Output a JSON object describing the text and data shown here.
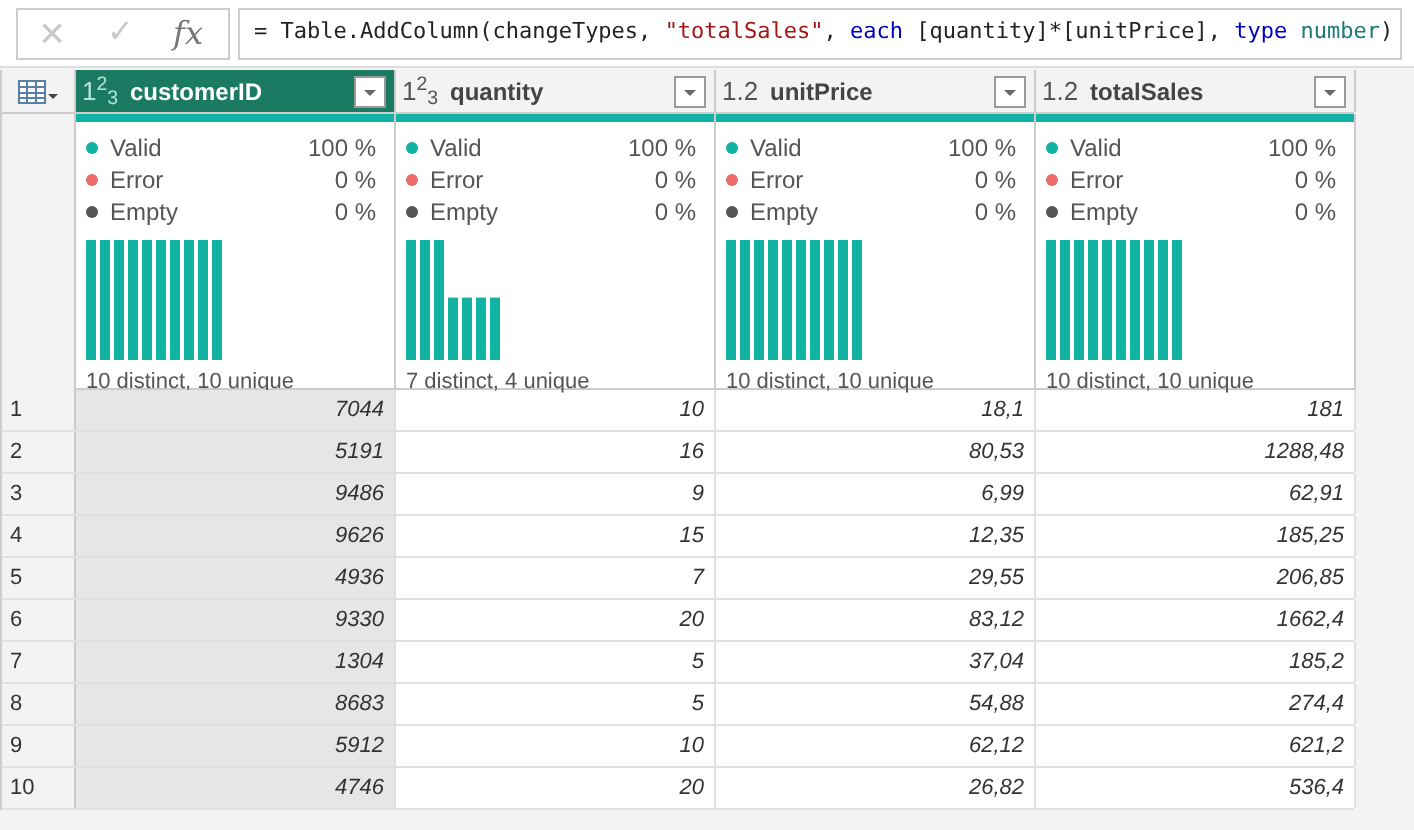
{
  "formula_bar": {
    "cancel": "×",
    "confirm": "✓",
    "fx": "fx",
    "formula": [
      {
        "kind": "plain",
        "text": "= Table.AddColumn(changeTypes, "
      },
      {
        "kind": "string",
        "text": "\"totalSales\""
      },
      {
        "kind": "plain",
        "text": ", "
      },
      {
        "kind": "keyword",
        "text": "each"
      },
      {
        "kind": "plain",
        "text": " [quantity]*[unitPrice], "
      },
      {
        "kind": "keyword",
        "text": "type"
      },
      {
        "kind": "type",
        "text": " number"
      },
      {
        "kind": "plain",
        "text": ")"
      }
    ]
  },
  "table": {
    "columns": [
      {
        "name": "customerID",
        "type_icon": "1$^{2}$$_{3}$",
        "selected": true,
        "stats": [
          {
            "label": "Valid",
            "value": "100 %"
          },
          {
            "label": "Error",
            "value": "0 %"
          },
          {
            "label": "Empty",
            "value": "0 %"
          }
        ],
        "profile": "10 distinct, 10 unique"
      },
      {
        "name": "quantity",
        "type_icon": "1$^{2}$$_{3}$",
        "selected": false,
        "stats": [
          {
            "label": "Valid",
            "value": "100 %"
          },
          {
            "label": "Error",
            "value": "0 %"
          },
          {
            "label": "Empty",
            "value": "0 %"
          }
        ],
        "profile": "7 distinct, 4 unique"
      },
      {
        "name": "unitPrice",
        "type_icon": "1.2",
        "selected": false,
        "stats": [
          {
            "label": "Valid",
            "value": "100 %"
          },
          {
            "label": "Error",
            "value": "0 %"
          },
          {
            "label": "Empty",
            "value": "0 %"
          }
        ],
        "profile": "10 distinct, 10 unique"
      },
      {
        "name": "totalSales",
        "type_icon": "1.2",
        "selected": false,
        "stats": [
          {
            "label": "Valid",
            "value": "100 %"
          },
          {
            "label": "Error",
            "value": "0 %"
          },
          {
            "label": "Empty",
            "value": "0 %"
          }
        ],
        "profile": "10 distinct, 10 unique"
      }
    ],
    "rows": [
      {
        "number": "1",
        "cells": [
          "7044",
          "10",
          "18,1",
          "181"
        ]
      },
      {
        "number": "2",
        "cells": [
          "5191",
          "16",
          "80,53",
          "1288,48"
        ]
      },
      {
        "number": "3",
        "cells": [
          "9486",
          "9",
          "6,99",
          "62,91"
        ]
      },
      {
        "number": "4",
        "cells": [
          "9626",
          "15",
          "12,35",
          "185,25"
        ]
      },
      {
        "number": "5",
        "cells": [
          "4936",
          "7",
          "29,55",
          "206,85"
        ]
      },
      {
        "number": "6",
        "cells": [
          "9330",
          "20",
          "83,12",
          "1662,4"
        ]
      },
      {
        "number": "7",
        "cells": [
          "1304",
          "5",
          "37,04",
          "185,2"
        ]
      },
      {
        "number": "8",
        "cells": [
          "8683",
          "5",
          "54,88",
          "274,4"
        ]
      },
      {
        "number": "9",
        "cells": [
          "5912",
          "10",
          "62,12",
          "621,2"
        ]
      },
      {
        "number": "10",
        "cells": [
          "4746",
          "20",
          "26,82",
          "536,4"
        ]
      }
    ]
  }
}
